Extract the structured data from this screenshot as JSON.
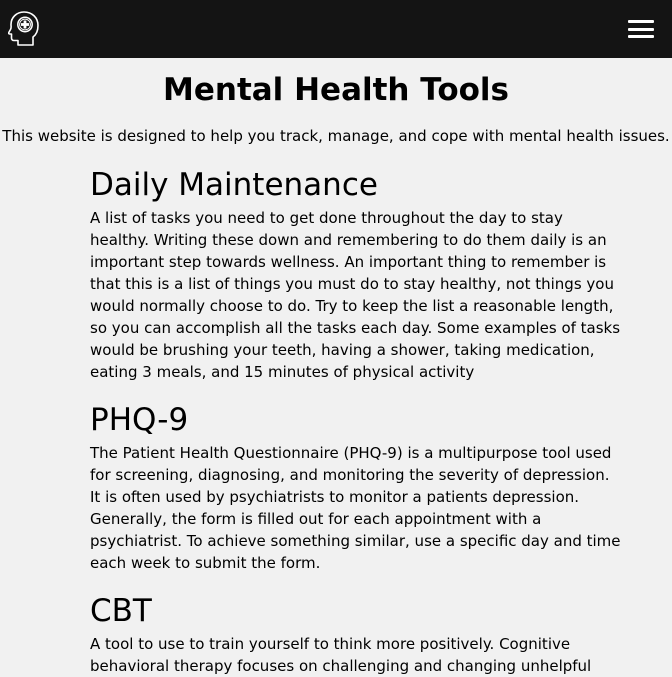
{
  "navbar": {
    "logo_icon": "head-with-medical-cross-icon",
    "menu_icon": "hamburger-menu-icon",
    "background": "#141414"
  },
  "page": {
    "title": "Mental Health Tools",
    "intro": "This website is designed to help you track, manage, and cope with mental health issues.",
    "background": "#f1f1f1"
  },
  "sections": [
    {
      "heading": "Daily Maintenance",
      "lines": [
        "A list of tasks you need to get done throughout the day to stay",
        "healthy. Writing these down and remembering to do them daily is an",
        "important step towards wellness. An important thing to remember is",
        "that this is a list of things you must do to stay healthy, not things you",
        "would normally choose to do. Try to keep the list a reasonable length,",
        "so you can accomplish all the tasks each day. Some examples of tasks",
        "would be brushing your teeth, having a shower, taking medication,",
        "eating 3 meals, and 15 minutes of physical activity"
      ]
    },
    {
      "heading": "PHQ-9",
      "lines": [
        "The Patient Health Questionnaire (PHQ-9) is a multipurpose tool used",
        "for screening, diagnosing, and monitoring the severity of depression.",
        "It is often used by psychiatrists to monitor a patients depression.",
        "Generally, the form is filled out for each appointment with a",
        "psychiatrist. To achieve something similar, use a specific day and time",
        "each week to submit the form."
      ]
    },
    {
      "heading": "CBT",
      "lines": [
        "A tool to use to train yourself to think more positively. Cognitive",
        "behavioral therapy focuses on challenging and changing unhelpful"
      ]
    }
  ]
}
